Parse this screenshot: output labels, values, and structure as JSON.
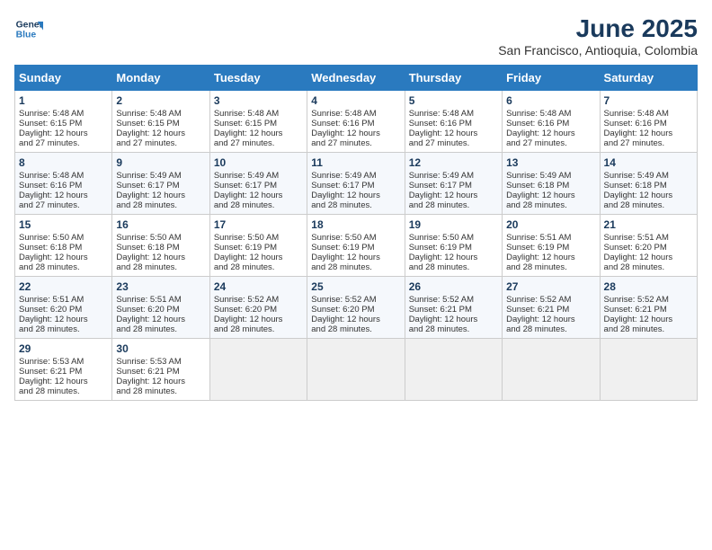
{
  "logo": {
    "line1": "General",
    "line2": "Blue"
  },
  "title": "June 2025",
  "location": "San Francisco, Antioquia, Colombia",
  "days_of_week": [
    "Sunday",
    "Monday",
    "Tuesday",
    "Wednesday",
    "Thursday",
    "Friday",
    "Saturday"
  ],
  "weeks": [
    [
      {
        "day": 1,
        "rise": "5:48 AM",
        "set": "6:15 PM",
        "hours": "12 hours and 27 minutes."
      },
      {
        "day": 2,
        "rise": "5:48 AM",
        "set": "6:15 PM",
        "hours": "12 hours and 27 minutes."
      },
      {
        "day": 3,
        "rise": "5:48 AM",
        "set": "6:15 PM",
        "hours": "12 hours and 27 minutes."
      },
      {
        "day": 4,
        "rise": "5:48 AM",
        "set": "6:16 PM",
        "hours": "12 hours and 27 minutes."
      },
      {
        "day": 5,
        "rise": "5:48 AM",
        "set": "6:16 PM",
        "hours": "12 hours and 27 minutes."
      },
      {
        "day": 6,
        "rise": "5:48 AM",
        "set": "6:16 PM",
        "hours": "12 hours and 27 minutes."
      },
      {
        "day": 7,
        "rise": "5:48 AM",
        "set": "6:16 PM",
        "hours": "12 hours and 27 minutes."
      }
    ],
    [
      {
        "day": 8,
        "rise": "5:48 AM",
        "set": "6:16 PM",
        "hours": "12 hours and 27 minutes."
      },
      {
        "day": 9,
        "rise": "5:49 AM",
        "set": "6:17 PM",
        "hours": "12 hours and 28 minutes."
      },
      {
        "day": 10,
        "rise": "5:49 AM",
        "set": "6:17 PM",
        "hours": "12 hours and 28 minutes."
      },
      {
        "day": 11,
        "rise": "5:49 AM",
        "set": "6:17 PM",
        "hours": "12 hours and 28 minutes."
      },
      {
        "day": 12,
        "rise": "5:49 AM",
        "set": "6:17 PM",
        "hours": "12 hours and 28 minutes."
      },
      {
        "day": 13,
        "rise": "5:49 AM",
        "set": "6:18 PM",
        "hours": "12 hours and 28 minutes."
      },
      {
        "day": 14,
        "rise": "5:49 AM",
        "set": "6:18 PM",
        "hours": "12 hours and 28 minutes."
      }
    ],
    [
      {
        "day": 15,
        "rise": "5:50 AM",
        "set": "6:18 PM",
        "hours": "12 hours and 28 minutes."
      },
      {
        "day": 16,
        "rise": "5:50 AM",
        "set": "6:18 PM",
        "hours": "12 hours and 28 minutes."
      },
      {
        "day": 17,
        "rise": "5:50 AM",
        "set": "6:19 PM",
        "hours": "12 hours and 28 minutes."
      },
      {
        "day": 18,
        "rise": "5:50 AM",
        "set": "6:19 PM",
        "hours": "12 hours and 28 minutes."
      },
      {
        "day": 19,
        "rise": "5:50 AM",
        "set": "6:19 PM",
        "hours": "12 hours and 28 minutes."
      },
      {
        "day": 20,
        "rise": "5:51 AM",
        "set": "6:19 PM",
        "hours": "12 hours and 28 minutes."
      },
      {
        "day": 21,
        "rise": "5:51 AM",
        "set": "6:20 PM",
        "hours": "12 hours and 28 minutes."
      }
    ],
    [
      {
        "day": 22,
        "rise": "5:51 AM",
        "set": "6:20 PM",
        "hours": "12 hours and 28 minutes."
      },
      {
        "day": 23,
        "rise": "5:51 AM",
        "set": "6:20 PM",
        "hours": "12 hours and 28 minutes."
      },
      {
        "day": 24,
        "rise": "5:52 AM",
        "set": "6:20 PM",
        "hours": "12 hours and 28 minutes."
      },
      {
        "day": 25,
        "rise": "5:52 AM",
        "set": "6:20 PM",
        "hours": "12 hours and 28 minutes."
      },
      {
        "day": 26,
        "rise": "5:52 AM",
        "set": "6:21 PM",
        "hours": "12 hours and 28 minutes."
      },
      {
        "day": 27,
        "rise": "5:52 AM",
        "set": "6:21 PM",
        "hours": "12 hours and 28 minutes."
      },
      {
        "day": 28,
        "rise": "5:52 AM",
        "set": "6:21 PM",
        "hours": "12 hours and 28 minutes."
      }
    ],
    [
      {
        "day": 29,
        "rise": "5:53 AM",
        "set": "6:21 PM",
        "hours": "12 hours and 28 minutes."
      },
      {
        "day": 30,
        "rise": "5:53 AM",
        "set": "6:21 PM",
        "hours": "12 hours and 28 minutes."
      },
      null,
      null,
      null,
      null,
      null
    ]
  ],
  "cell_labels": {
    "sunrise": "Sunrise:",
    "sunset": "Sunset:",
    "daylight": "Daylight:"
  }
}
